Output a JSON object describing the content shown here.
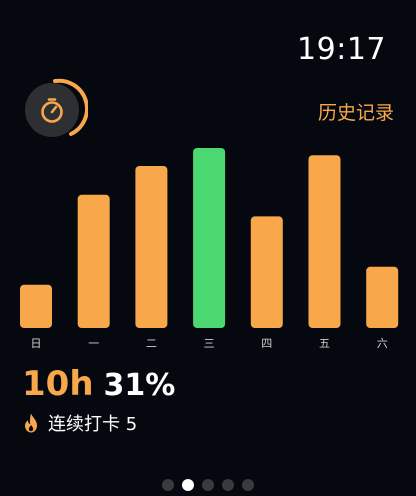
{
  "status": {
    "time": "19:17"
  },
  "header": {
    "timer_icon": "stopwatch-icon",
    "history_label": "历史记录"
  },
  "colors": {
    "accent": "#f8a84a",
    "today": "#4cd870",
    "background": "#06080f",
    "day_label": "#cfcfcf"
  },
  "chart_data": {
    "type": "bar",
    "categories": [
      "日",
      "一",
      "二",
      "三",
      "四",
      "五",
      "六"
    ],
    "values": [
      0.24,
      0.74,
      0.9,
      1.0,
      0.62,
      0.96,
      0.34
    ],
    "highlight_index": 3
  },
  "summary": {
    "total_time": "10h",
    "percent": "31%"
  },
  "streak": {
    "icon": "flame-icon",
    "label": "连续打卡 5"
  },
  "pager": {
    "count": 5,
    "active_index": 1
  }
}
